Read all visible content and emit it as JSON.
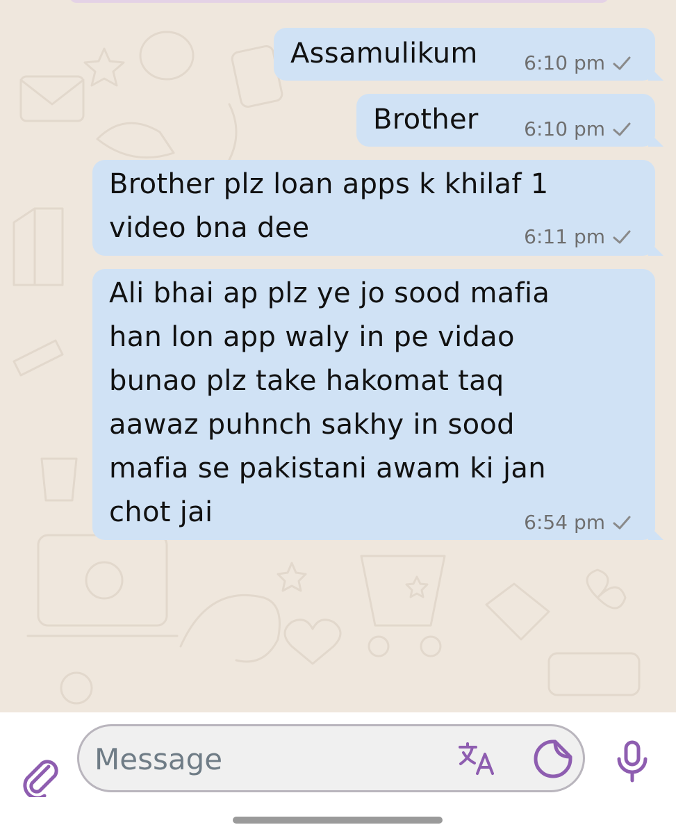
{
  "chat": {
    "messages": [
      {
        "text": "Assamulikum",
        "time": "6:10 pm",
        "status": "sent"
      },
      {
        "text": "Brother",
        "time": "6:10 pm",
        "status": "sent"
      },
      {
        "text": "Brother plz loan apps k khilaf 1\nvideo bna dee",
        "time": "6:11 pm",
        "status": "sent"
      },
      {
        "text": "Ali bhai ap plz ye jo sood mafia\nhan lon app waly in pe vidao\nbunao plz take hakomat taq\naawaz puhnch sakhy in sood\nmafia se pakistani awam ki jan\nchot jai",
        "time": "6:54 pm",
        "status": "sent"
      }
    ]
  },
  "composer": {
    "placeholder": "Message",
    "attach_icon": "paperclip-icon",
    "translate_icon": "translate-icon",
    "sticker_icon": "sticker-icon",
    "mic_icon": "microphone-icon"
  },
  "colors": {
    "wallpaper": "#efe7dd",
    "outgoing_bubble": "#d0e2f5",
    "accent": "#8e5db0",
    "timestamp": "#6f6f6f"
  }
}
